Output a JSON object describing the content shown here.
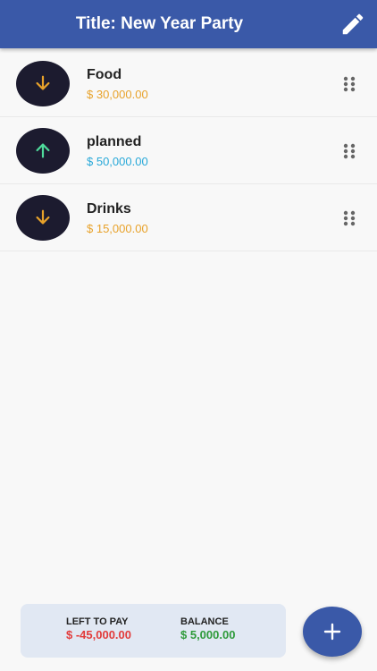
{
  "header": {
    "title": "Title: New Year Party",
    "edit_icon": "pencil-icon",
    "color": "#3a59a8"
  },
  "items": [
    {
      "name": "Food",
      "amount": "$ 30,000.00",
      "direction": "down",
      "icon": "arrow-down-icon",
      "color": "#e8a22a"
    },
    {
      "name": "planned",
      "amount": "$ 50,000.00",
      "direction": "up",
      "icon": "arrow-up-icon",
      "color": "#27a8d8"
    },
    {
      "name": "Drinks",
      "amount": "$ 15,000.00",
      "direction": "down",
      "icon": "arrow-down-icon",
      "color": "#e8a22a"
    }
  ],
  "summary": {
    "left_to_pay_label": "LEFT TO PAY",
    "left_to_pay_value": "$ -45,000.00",
    "balance_label": "BALANCE",
    "balance_value": "$ 5,000.00",
    "negative_color": "#e23b3b",
    "positive_color": "#2e9a3a"
  },
  "fab": {
    "icon": "plus-icon"
  }
}
